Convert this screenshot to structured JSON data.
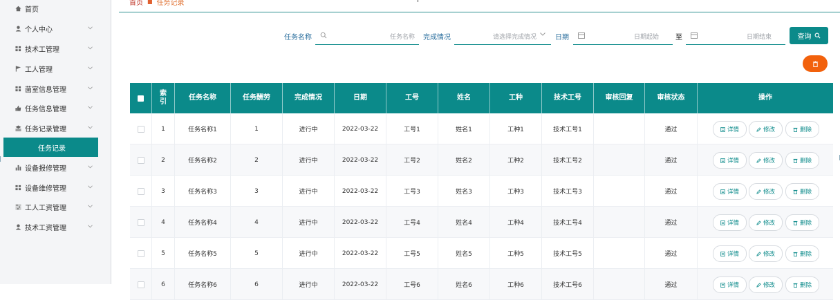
{
  "sidebar": {
    "items": [
      {
        "label": "首页",
        "icon": "home-icon",
        "has_chevron": false
      },
      {
        "label": "个人中心",
        "icon": "user-icon",
        "has_chevron": true
      },
      {
        "label": "技术工管理",
        "icon": "grid-icon",
        "has_chevron": true
      },
      {
        "label": "工人管理",
        "icon": "flag-icon",
        "has_chevron": true
      },
      {
        "label": "菌室信息管理",
        "icon": "grid-icon",
        "has_chevron": true
      },
      {
        "label": "任务信息管理",
        "icon": "thumb-icon",
        "has_chevron": true
      },
      {
        "label": "任务记录管理",
        "icon": "layers-icon",
        "has_chevron": true,
        "expanded": true
      },
      {
        "label": "设备报修管理",
        "icon": "bar-chart-icon",
        "has_chevron": true
      },
      {
        "label": "设备维修管理",
        "icon": "grid-icon",
        "has_chevron": true
      },
      {
        "label": "工人工资管理",
        "icon": "sliders-icon",
        "has_chevron": true
      },
      {
        "label": "技术工资管理",
        "icon": "user-icon",
        "has_chevron": true
      }
    ],
    "active_sub": "任务记录"
  },
  "breadcrumb": {
    "home": "首页",
    "current": "任务记录"
  },
  "search": {
    "task_name_label": "任务名称",
    "task_name_placeholder": "任务名称",
    "status_label": "完成情况",
    "status_placeholder": "请选择完成情况",
    "date_label": "日期",
    "date_start_placeholder": "日期起始",
    "to_label": "至",
    "date_end_placeholder": "日期结束",
    "search_button": "查询"
  },
  "colors": {
    "primary": "#0b8a8a",
    "danger": "#f2610c",
    "sidebar_bg": "#f4f5f7"
  },
  "table": {
    "headers": [
      "",
      "索\n引",
      "任务名称",
      "任务酬劳",
      "完成情况",
      "日期",
      "工号",
      "姓名",
      "工种",
      "技术工号",
      "审核回复",
      "审核状态",
      "操作"
    ],
    "rows": [
      {
        "index": "1",
        "name": "任务名称1",
        "reward": "1",
        "status": "进行中",
        "date": "2022-03-22",
        "worker_no": "工号1",
        "worker_name": "姓名1",
        "job": "工种1",
        "tech_no": "技术工号1",
        "reply": "",
        "audit": "通过"
      },
      {
        "index": "2",
        "name": "任务名称2",
        "reward": "2",
        "status": "进行中",
        "date": "2022-03-22",
        "worker_no": "工号2",
        "worker_name": "姓名2",
        "job": "工种2",
        "tech_no": "技术工号2",
        "reply": "",
        "audit": "通过"
      },
      {
        "index": "3",
        "name": "任务名称3",
        "reward": "3",
        "status": "进行中",
        "date": "2022-03-22",
        "worker_no": "工号3",
        "worker_name": "姓名3",
        "job": "工种3",
        "tech_no": "技术工号3",
        "reply": "",
        "audit": "通过"
      },
      {
        "index": "4",
        "name": "任务名称4",
        "reward": "4",
        "status": "进行中",
        "date": "2022-03-22",
        "worker_no": "工号4",
        "worker_name": "姓名4",
        "job": "工种4",
        "tech_no": "技术工号4",
        "reply": "",
        "audit": "通过"
      },
      {
        "index": "5",
        "name": "任务名称5",
        "reward": "5",
        "status": "进行中",
        "date": "2022-03-22",
        "worker_no": "工号5",
        "worker_name": "姓名5",
        "job": "工种5",
        "tech_no": "技术工号5",
        "reply": "",
        "audit": "通过"
      },
      {
        "index": "6",
        "name": "任务名称6",
        "reward": "6",
        "status": "进行中",
        "date": "2022-03-22",
        "worker_no": "工号6",
        "worker_name": "姓名6",
        "job": "工种6",
        "tech_no": "技术工号6",
        "reply": "",
        "audit": "通过"
      }
    ],
    "actions": {
      "detail": "详情",
      "edit": "修改",
      "delete": "删除"
    }
  }
}
